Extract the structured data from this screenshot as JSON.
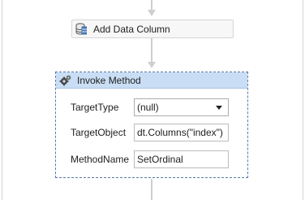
{
  "activities": {
    "add_data_column": {
      "label": "Add Data Column",
      "icon": "database-table-icon"
    },
    "invoke_method": {
      "title": "Invoke Method",
      "icon": "gears-icon",
      "properties": {
        "target_type": {
          "label": "TargetType",
          "value": "(null)"
        },
        "target_object": {
          "label": "TargetObject",
          "value": "dt.Columns(\"index\")"
        },
        "method_name": {
          "label": "MethodName",
          "value": "SetOrdinal"
        }
      }
    }
  },
  "colors": {
    "selected_border": "#5a7aa8",
    "header_background": "#c9def4",
    "connector": "#cfcfcf"
  }
}
